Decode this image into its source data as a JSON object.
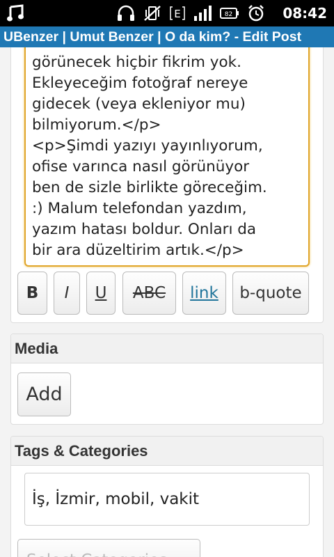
{
  "status_bar": {
    "time": "08:42",
    "icons": [
      "music-note-icon",
      "headset-icon",
      "vibrate-off-icon",
      "edge-network-icon",
      "signal-bars-icon",
      "battery-icon",
      "alarm-clock-icon"
    ],
    "battery_level": "82",
    "network_label": "E"
  },
  "title_bar": {
    "title": "UBenzer | Umut Benzer | O da kim? - Edit Post",
    "color": "#1f78b4"
  },
  "post_editor": {
    "content_lines": [
      "görünecek hiçbir fikrim yok.",
      "Ekleyeceğim fotoğraf nereye",
      "gidecek (veya ekleniyor mu)",
      "bilmiyorum.</p>",
      "<p>Şimdi yazıyı yayınlıyorum,",
      "ofise varınca nasıl görünüyor",
      "ben de sizle birlikte göreceğim.",
      ":) Malum telefondan yazdım,",
      "yazım hatası boldur. Onları da",
      "bir ara düzeltirim artık.</p>"
    ],
    "toolbar": {
      "bold": "B",
      "italic": "I",
      "underline": "U",
      "strike": "ABC",
      "link": "link",
      "bquote": "b-quote"
    },
    "focus_color": "#e0a52a"
  },
  "media": {
    "header": "Media",
    "add_label": "Add"
  },
  "tags": {
    "header": "Tags & Categories",
    "value": "İş, İzmir, mobil, vakit",
    "select_categories_label": "Select Categories"
  }
}
